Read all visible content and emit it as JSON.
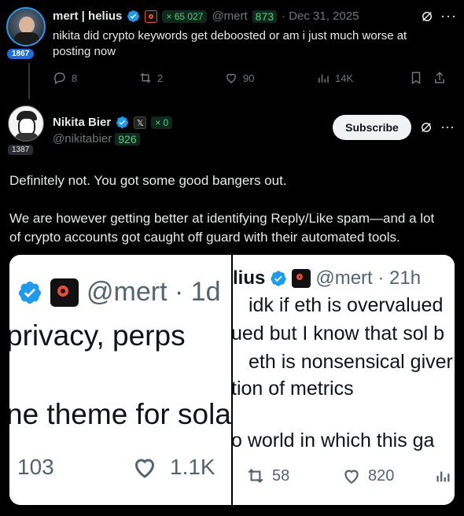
{
  "tweet1": {
    "name": "mert | helius",
    "follower_badge": "× 65 027",
    "handle": "@mert",
    "handle_score": "873",
    "date": "· Dec 31, 2025",
    "text_line1": "nikita did crypto keywords get deboosted or am i just much worse at",
    "text_line2": "posting now",
    "avatar_count": "1867",
    "replies": "8",
    "reposts": "2",
    "likes": "90",
    "views": "14K"
  },
  "tweet2": {
    "name": "Nikita Bier",
    "badge_x": "× 0",
    "handle": "@nikitabier",
    "handle_score": "926",
    "avatar_count": "1387",
    "subscribe_label": "Subscribe",
    "para1": "Definitely not. You got some good bangers out.",
    "para2_line1": "We are however getting better at identifying Reply/Like spam—and a lot",
    "para2_line2": "of crypto accounts got caught off guard with their automated tools."
  },
  "image_left": {
    "handle": "@mert · 1d",
    "line1": "privacy, perps",
    "line2": "ne theme for sola",
    "count1": "103",
    "count2": "1.1K"
  },
  "image_right": {
    "name_frag": "lius",
    "handle": "@mert · 21h",
    "line1": "idk if eth is overvalued",
    "line2": "ued but I know that sol b",
    "line3": "eth is nonsensical giver",
    "line4": "tion of metrics",
    "line5": "o world in which this ga",
    "reposts": "58",
    "likes": "820"
  },
  "colors": {
    "accent": "#1d9bf0",
    "green": "#4cd07d",
    "background": "#000000"
  }
}
